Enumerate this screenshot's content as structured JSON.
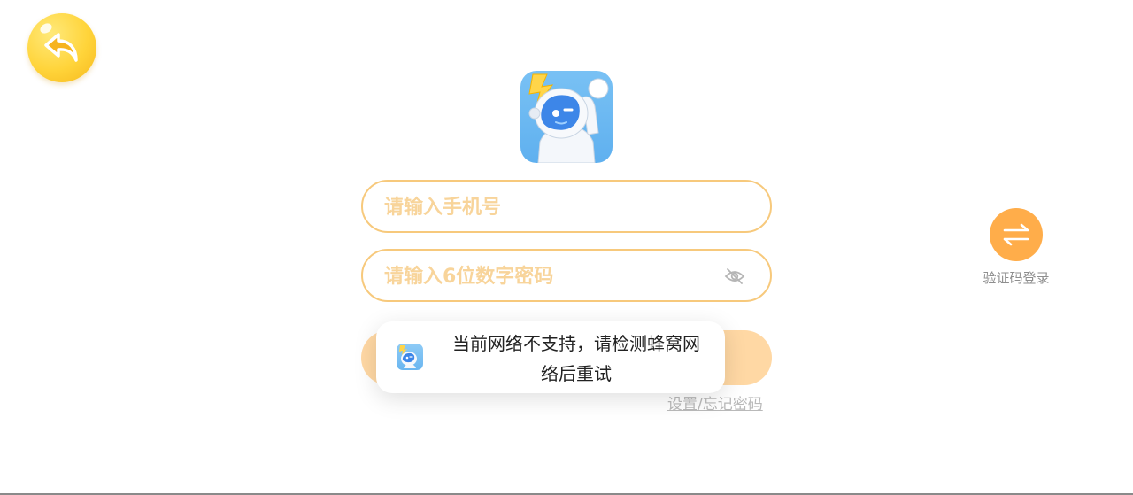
{
  "header": {
    "back_icon": "back-arrow-icon"
  },
  "logo": {
    "icon": "robot-mascot-icon"
  },
  "login_form": {
    "phone_placeholder": "请输入手机号",
    "phone_value": "",
    "password_placeholder": "请输入6位数字密码",
    "password_value": "",
    "password_toggle_icon": "eye-hidden-icon",
    "login_button_label": "",
    "forgot_link": "设置/忘记密码"
  },
  "switch_login": {
    "icon": "swap-arrows-icon",
    "label": "验证码登录"
  },
  "toast": {
    "icon": "app-logo-icon",
    "message": "当前网络不支持，请检测蜂窝网络后重试"
  },
  "colors": {
    "accent": "#ffad4a",
    "field_border": "#f7c97c",
    "placeholder": "#f8d49a",
    "back_button": "#ffd43a",
    "logo_bg": "#6ab6f0"
  }
}
